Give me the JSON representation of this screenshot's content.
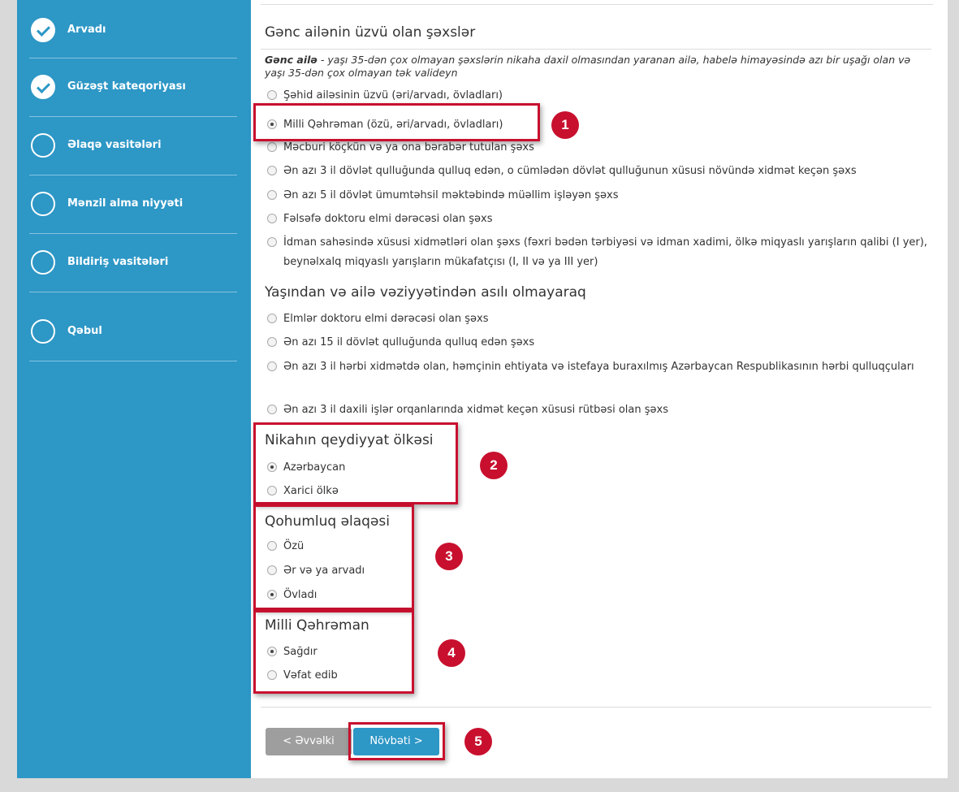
{
  "sidebar": {
    "steps": [
      {
        "label": "Arvadı",
        "done": true
      },
      {
        "label": "Güzəşt kateqoriyası",
        "done": true
      },
      {
        "label": "Əlaqə vasitələri",
        "done": false
      },
      {
        "label": "Mənzil alma niyyəti",
        "done": false
      },
      {
        "label": "Bildiriş vasitələri",
        "done": false
      },
      {
        "label": "Qəbul",
        "done": false
      }
    ]
  },
  "young_family": {
    "title": "Gənc ailənin üzvü olan şəxslər",
    "note_bold": "Gənc ailə",
    "note_text": " - yaşı 35-dən çox olmayan şəxslərin nikaha daxil olmasından yaranan ailə, habelə himayəsində azı bir uşağı olan və yaşı 35-dən çox olmayan tək valideyn",
    "options": [
      "Şəhid ailəsinin üzvü (əri/arvadı, övladları)",
      "Milli Qəhrəman (özü, əri/arvadı, övladları)",
      "Məcburi köçkün və ya ona bərabər tutulan şəxs",
      "Ən azı 3 il dövlət qulluğunda qulluq edən, o cümlədən dövlət qulluğunun xüsusi növündə xidmət keçən şəxs",
      "Ən azı 5 il dövlət ümumtəhsil məktəbində müəllim işləyən şəxs",
      "Fəlsəfə doktoru elmi dərəcəsi olan şəxs",
      "İdman sahəsində xüsusi xidmətləri olan şəxs (fəxri bədən tərbiyəsi və idman xadimi, ölkə miqyaslı yarışların qalibi (I yer), beynəlxalq miqyaslı yarışların mükafatçısı (I, II və ya III yer)"
    ],
    "selected_index": 1
  },
  "regardless": {
    "title": "Yaşından və ailə vəziyyətindən asılı olmayaraq",
    "options": [
      "Elmlər doktoru elmi dərəcəsi olan şəxs",
      "Ən azı 15 il dövlət qulluğunda qulluq edən şəxs",
      "Ən azı 3 il hərbi xidmətdə olan, həmçinin ehtiyata və istefaya buraxılmış Azərbaycan Respublikasının hərbi qulluqçuları",
      "Ən azı 3 il daxili işlər orqanlarında xidmət keçən xüsusi rütbəsi olan şəxs"
    ]
  },
  "marriage_country": {
    "title": "Nikahın qeydiyyat ölkəsi",
    "options": [
      "Azərbaycan",
      "Xarici ölkə"
    ],
    "selected_index": 0
  },
  "kinship": {
    "title": "Qohumluq əlaqəsi",
    "options": [
      "Özü",
      "Ər və ya arvadı",
      "Övladı"
    ],
    "selected_index": 2
  },
  "hero_status": {
    "title": "Milli Qəhrəman",
    "options": [
      "Sağdır",
      "Vəfat edib"
    ],
    "selected_index": 0
  },
  "buttons": {
    "prev": "< Əvvəlki",
    "next": "Növbəti >"
  },
  "annotations": [
    "1",
    "2",
    "3",
    "4",
    "5"
  ],
  "colors": {
    "sidebar": "#2d97c6",
    "highlight": "#c8102e",
    "next_button": "#2d97c6",
    "prev_button": "#9e9e9e"
  }
}
